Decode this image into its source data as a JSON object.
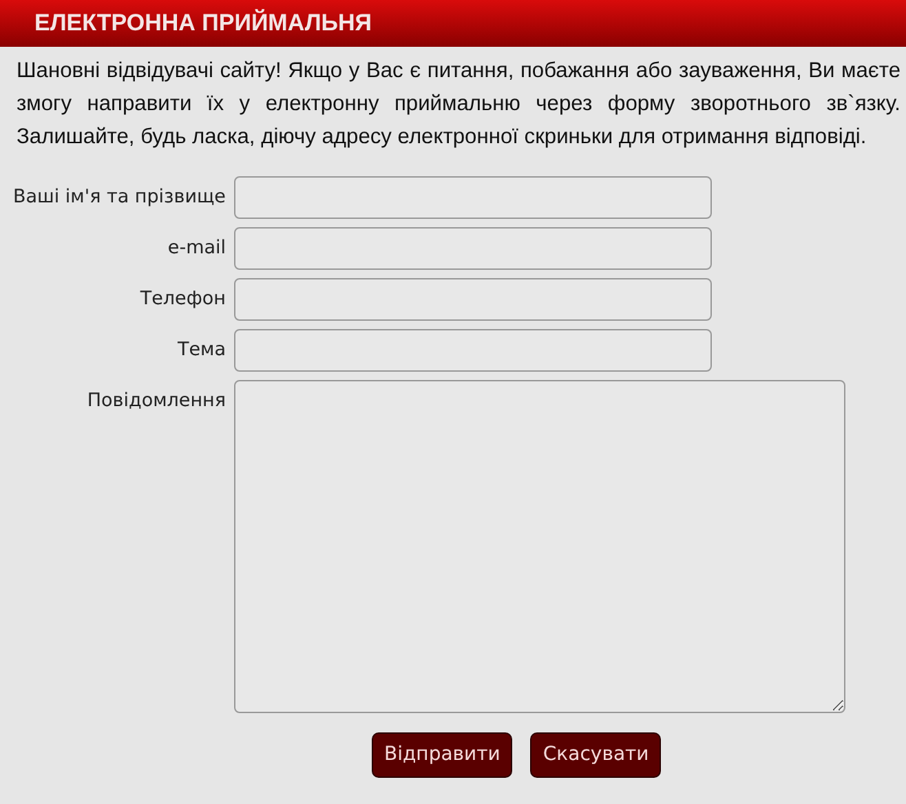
{
  "header": {
    "title": "ЕЛЕКТРОННА ПРИЙМАЛЬНЯ"
  },
  "intro": "Шановні відвідувачі сайту! Якщо у Вас є питання, побажання або зауваження, Ви маєте змогу направити їх у електронну приймальню через форму зворотнього зв`язку. Залишайте, будь ласка, діючу адресу електронної скриньки для отримання відповіді.",
  "fields": [
    {
      "label": "Ваші ім'я та прізвище",
      "kind": "input"
    },
    {
      "label": "e-mail",
      "kind": "input"
    },
    {
      "label": "Телефон",
      "kind": "input"
    },
    {
      "label": "Тема",
      "kind": "input"
    },
    {
      "label": "Повідомлення",
      "kind": "textarea"
    }
  ],
  "buttons": [
    "Відправити",
    "Скасувати"
  ]
}
